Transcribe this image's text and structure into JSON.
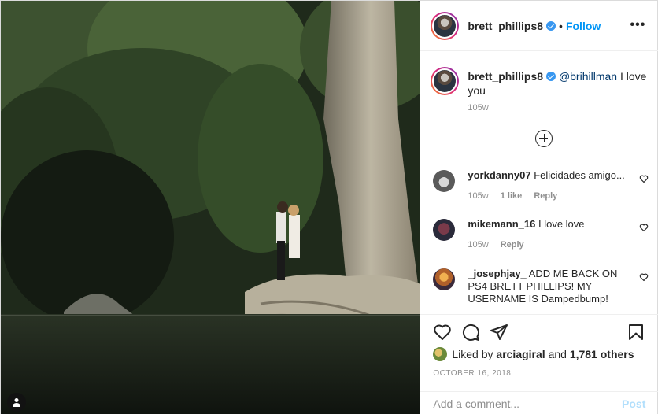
{
  "post": {
    "author": "brett_phillips8",
    "dot": "•",
    "follow_label": "Follow",
    "more_label": "•••",
    "caption": {
      "mention": "@brihillman",
      "text": " I love you",
      "time": "105w"
    },
    "comments": [
      {
        "user": "yorkdanny07",
        "text": "Felicidades amigo...",
        "time": "105w",
        "likes": "1 like",
        "reply": "Reply"
      },
      {
        "user": "mikemann_16",
        "text": "I love love",
        "time": "105w",
        "likes": "",
        "reply": "Reply"
      },
      {
        "user": "_josephjay_",
        "text": "ADD ME BACK ON PS4 BRETT PHILLIPS! MY USERNAME IS Dampedbump!",
        "time": "",
        "likes": "",
        "reply": ""
      }
    ],
    "likes": {
      "prefix": "Liked by ",
      "user": "arciagiral",
      "middle": " and ",
      "count": "1,781 others"
    },
    "date": "OCTOBER 16, 2018",
    "add_comment_placeholder": "Add a comment...",
    "post_label": "Post"
  },
  "icons": {
    "verified": "verified-badge-icon",
    "more": "more-options-icon",
    "load_more": "plus-circle-icon",
    "like": "heart-icon",
    "comment": "comment-bubble-icon",
    "share": "paper-plane-icon",
    "save": "bookmark-icon",
    "user_tag": "user-tag-icon"
  },
  "colors": {
    "link": "#0095f6",
    "verified": "#3897f0",
    "mention": "#00376b",
    "muted": "#8e8e8e",
    "post_disabled": "#b2dffc"
  }
}
